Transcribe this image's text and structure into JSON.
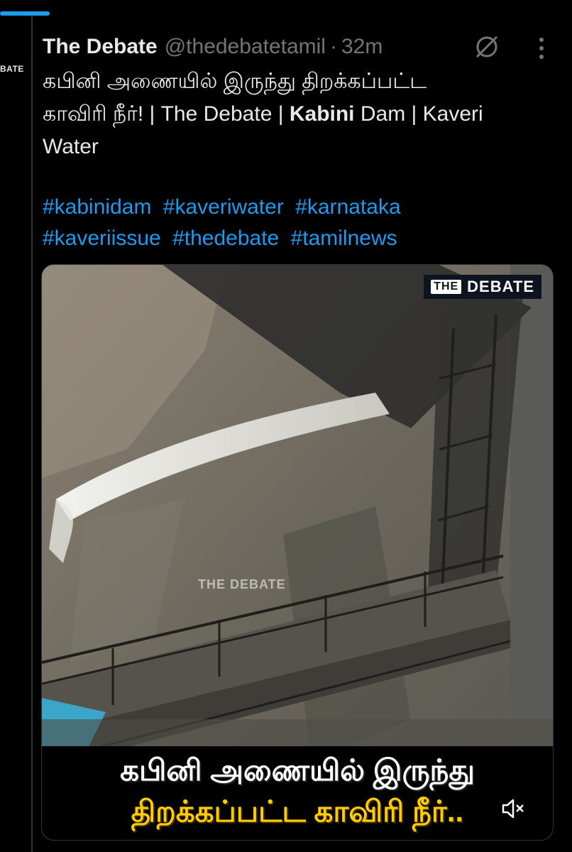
{
  "app": {
    "accent_color": "#1d9bf0",
    "background": "#000000"
  },
  "avatar": {
    "label": "BATE"
  },
  "tweet": {
    "display_name": "The Debate",
    "handle": "@thedebatetamil",
    "separator": "·",
    "timestamp": "32m",
    "text_line1": "கபினி அணையில் இருந்து திறக்கப்பட்ட",
    "text_line2a": "காவிரி நீர்! | The Debate | ",
    "text_bold": "Kabini",
    "text_line2b": " Dam | Kaveri",
    "text_line3": "Water",
    "hashtags": [
      "#kabinidam",
      "#kaveriwater",
      "#karnataka",
      "#kaveriissue",
      "#thedebate",
      "#tamilnews"
    ]
  },
  "icons": {
    "grok": "grok-icon",
    "more": "more-options-icon",
    "mute": "volume-muted-icon"
  },
  "media": {
    "logo_the": "THE",
    "logo_debate": "DEBATE",
    "watermark": "THE DEBATE",
    "caption_line1": "கபினி அணையில் இருந்து",
    "caption_line2": "திறக்கப்பட்ட காவிரி நீர்..",
    "caption_color_line2": "#ffcc00"
  }
}
